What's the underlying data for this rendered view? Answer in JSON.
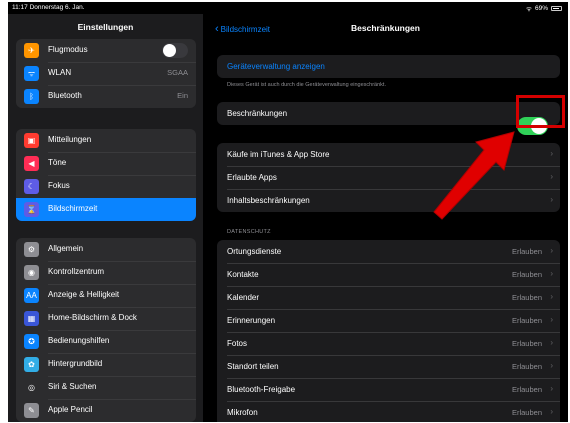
{
  "status": {
    "time": "11:17",
    "date": "Donnerstag 6. Jan.",
    "wifi": "ᯤ",
    "battery": "69%"
  },
  "sidebar": {
    "title": "Einstellungen",
    "group1": [
      {
        "label": "Flugmodus",
        "icon": "airplane-icon",
        "color": "#ff9500",
        "glyph": "✈",
        "toggle": "off"
      },
      {
        "label": "WLAN",
        "icon": "wifi-icon",
        "color": "#0a84ff",
        "glyph": "ᯤ",
        "value": "SGAA"
      },
      {
        "label": "Bluetooth",
        "icon": "bluetooth-icon",
        "color": "#0a84ff",
        "glyph": "ᛒ",
        "value": "Ein"
      }
    ],
    "group2": [
      {
        "label": "Mitteilungen",
        "icon": "notifications-icon",
        "color": "#ff3b30",
        "glyph": "▣"
      },
      {
        "label": "Töne",
        "icon": "sounds-icon",
        "color": "#ff2d55",
        "glyph": "◀"
      },
      {
        "label": "Fokus",
        "icon": "moon-icon",
        "color": "#5e5ce6",
        "glyph": "☾"
      },
      {
        "label": "Bildschirmzeit",
        "icon": "hourglass-icon",
        "color": "#5e5ce6",
        "glyph": "⌛",
        "selected": true
      }
    ],
    "group3": [
      {
        "label": "Allgemein",
        "icon": "gear-icon",
        "color": "#8e8e93",
        "glyph": "⚙"
      },
      {
        "label": "Kontrollzentrum",
        "icon": "control-center-icon",
        "color": "#8e8e93",
        "glyph": "◉"
      },
      {
        "label": "Anzeige & Helligkeit",
        "icon": "display-icon",
        "color": "#0a84ff",
        "glyph": "AA"
      },
      {
        "label": "Home-Bildschirm & Dock",
        "icon": "home-screen-icon",
        "color": "#3a56d8",
        "glyph": "▦"
      },
      {
        "label": "Bedienungshilfen",
        "icon": "accessibility-icon",
        "color": "#0a84ff",
        "glyph": "✪"
      },
      {
        "label": "Hintergrundbild",
        "icon": "wallpaper-icon",
        "color": "#32ade6",
        "glyph": "✿"
      },
      {
        "label": "Siri & Suchen",
        "icon": "siri-icon",
        "color": "#2c2c2e",
        "glyph": "◎"
      },
      {
        "label": "Apple Pencil",
        "icon": "pencil-icon",
        "color": "#8e8e93",
        "glyph": "✎"
      }
    ]
  },
  "main": {
    "back_label": "Bildschirmzeit",
    "title": "Beschränkungen",
    "device_management_link": "Geräteverwaltung anzeigen",
    "device_management_note": "Dieses Gerät ist auch durch die Geräteverwaltung eingeschränkt.",
    "restrictions_label": "Beschränkungen",
    "restrictions_toggle": "on",
    "store_rows": [
      "Käufe im iTunes & App Store",
      "Erlaubte Apps",
      "Inhaltsbeschränkungen"
    ],
    "privacy_header": "DATENSCHUTZ",
    "privacy_rows": [
      {
        "label": "Ortungsdienste",
        "value": "Erlauben"
      },
      {
        "label": "Kontakte",
        "value": "Erlauben"
      },
      {
        "label": "Kalender",
        "value": "Erlauben"
      },
      {
        "label": "Erinnerungen",
        "value": "Erlauben"
      },
      {
        "label": "Fotos",
        "value": "Erlauben"
      },
      {
        "label": "Standort teilen",
        "value": "Erlauben"
      },
      {
        "label": "Bluetooth-Freigabe",
        "value": "Erlauben"
      },
      {
        "label": "Mikrofon",
        "value": "Erlauben"
      }
    ]
  },
  "annotation": {
    "highlight_color": "#d40000",
    "arrow_color": "#e00000"
  }
}
